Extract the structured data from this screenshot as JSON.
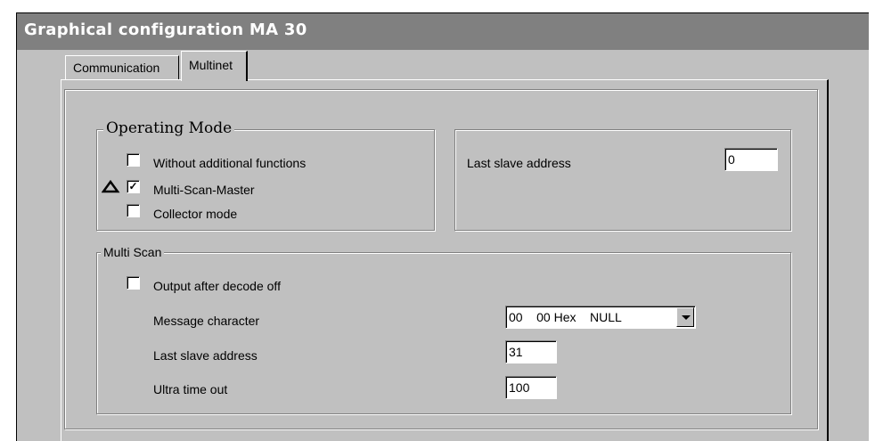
{
  "window": {
    "title": "Graphical configuration MA 30"
  },
  "tabs": [
    {
      "label": "Communication",
      "selected": false
    },
    {
      "label": "Multinet",
      "selected": true
    }
  ],
  "operating_mode": {
    "title": "Operating Mode",
    "options": [
      {
        "label": "Without additional functions",
        "checked": false
      },
      {
        "label": "Multi-Scan-Master",
        "checked": true
      },
      {
        "label": "Collector mode",
        "checked": false
      }
    ],
    "checkmark": "✓"
  },
  "last_slave_top": {
    "label": "Last slave address",
    "value": "0"
  },
  "multi_scan": {
    "title": "Multi Scan",
    "output_after_decode_off": {
      "label": "Output after decode off",
      "checked": false
    },
    "message_character": {
      "label": "Message character",
      "value": "00    00 Hex    NULL"
    },
    "last_slave_address": {
      "label": "Last slave address",
      "value": "31"
    },
    "ultra_time_out": {
      "label": "Ultra time out",
      "value": "100"
    }
  }
}
